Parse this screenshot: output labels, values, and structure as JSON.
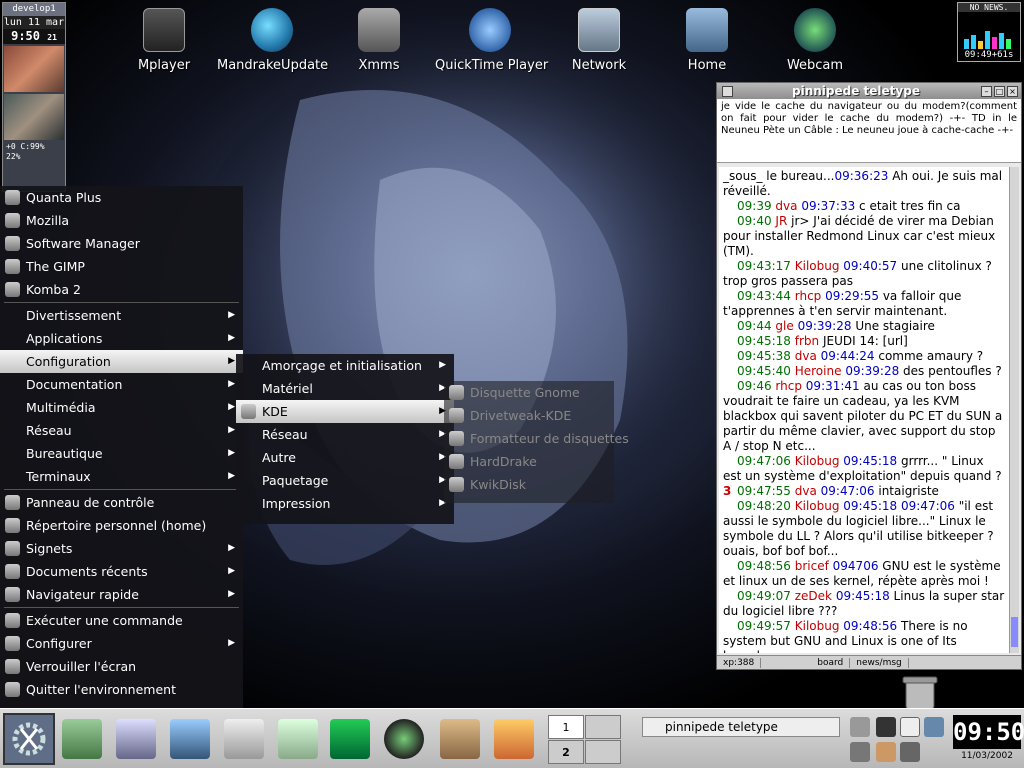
{
  "desktop_icons": [
    {
      "label": "Mplayer",
      "icon": "film-icon"
    },
    {
      "label": "MandrakeUpdate",
      "icon": "globe-icon"
    },
    {
      "label": "Xmms",
      "icon": "speaker-icon"
    },
    {
      "label": "QuickTime Player",
      "icon": "quicktime-icon"
    },
    {
      "label": "Network",
      "icon": "network-icon"
    },
    {
      "label": "Home",
      "icon": "home-icon"
    },
    {
      "label": "Webcam",
      "icon": "webcam-icon"
    }
  ],
  "gkrellm": {
    "host": "develop1",
    "date": "lun 11 mar",
    "time": "9:50",
    "seconds": "21",
    "stats1": "+0  C:99%",
    "stats2": "22%"
  },
  "news_applet": {
    "header": "NO NEWS.",
    "clock": "09:49+61s"
  },
  "chat": {
    "title": "pinnipede teletype",
    "topic": "je vide le cache du navigateur ou du modem?(comment on fait pour vider le cache du modem?) -+- TD in le Neuneu Pète un Câble : Le neuneu joue à cache-cache -+-",
    "messages": [
      {
        "ts": "",
        "nick": "",
        "nickcolor": "",
        "ref": "",
        "text": "_sous_ le bureau...",
        "ref2": "09:36:23",
        "text2": " Ah oui. Je suis mal réveillé."
      },
      {
        "ts": "09:39",
        "nick": "dva",
        "nickcolor": "red",
        "ref": "09:37:33",
        "text": " c etait tres fin ca"
      },
      {
        "ts": "09:40",
        "nick": "JR",
        "nickcolor": "red",
        "ref": "",
        "text": " jr> J'ai décidé de virer ma Debian pour installer Redmond Linux car c'est mieux (TM)."
      },
      {
        "ts": "09:43:17",
        "nick": "Kilobug",
        "nickcolor": "red",
        "ref": "09:40:57",
        "text": " une clitolinux ? trop gros passera pas"
      },
      {
        "ts": "09:43:44",
        "nick": "rhcp",
        "nickcolor": "red",
        "ref": "09:29:55",
        "text": " va falloir que t'apprennes à t'en servir maintenant."
      },
      {
        "ts": "09:44",
        "nick": "gle",
        "nickcolor": "red",
        "ref": "09:39:28",
        "text": " Une stagiaire"
      },
      {
        "ts": "09:45:18",
        "nick": "frbn",
        "nickcolor": "red",
        "ref": "",
        "text": " JEUDI 14: [url]"
      },
      {
        "ts": "09:45:38",
        "nick": "dva",
        "nickcolor": "red",
        "ref": "09:44:24",
        "text": " comme amaury ?"
      },
      {
        "ts": "09:45:40",
        "nick": "Heroine",
        "nickcolor": "red",
        "ref": "09:39:28",
        "text": " des pentoufles ?"
      },
      {
        "ts": "09:46",
        "nick": "rhcp",
        "nickcolor": "red",
        "ref": "09:31:41",
        "text": " au cas ou ton boss voudrait te faire un cadeau, ya les KVM blackbox qui savent piloter du PC ET du SUN a partir du même clavier, avec support du stop A / stop N etc..."
      },
      {
        "ts": "09:47:06",
        "nick": "Kilobug",
        "nickcolor": "red",
        "ref": "09:45:18",
        "text": " grrrr... \" Linux est un système d'exploitation\" depuis quand ?"
      },
      {
        "ts": "09:47:55",
        "nick": "dva",
        "nickcolor": "red",
        "ref": "09:47:06",
        "text": " intaigriste",
        "mark": "3"
      },
      {
        "ts": "09:48:20",
        "nick": "Kilobug",
        "nickcolor": "red",
        "ref": "09:45:18 09:47:06",
        "text": " \"il est aussi le symbole du logiciel libre...\" Linux le symbole du LL ? Alors qu'il utilise bitkeeper ? ouais, bof bof bof..."
      },
      {
        "ts": "09:48:56",
        "nick": "bricef",
        "nickcolor": "red",
        "ref": "094706",
        "text": " GNU est le système et linux un de ses kernel, répète après moi !"
      },
      {
        "ts": "09:49:07",
        "nick": "zeDek",
        "nickcolor": "red",
        "ref": "09:45:18",
        "text": " Linus la super star du logiciel libre ???"
      },
      {
        "ts": "09:49:57",
        "nick": "Kilobug",
        "nickcolor": "red",
        "ref": "09:48:56",
        "text": " There is no system but GNU and Linux is one of Its kernels."
      }
    ],
    "status": {
      "xp": "xp:388",
      "board": "board",
      "news": "news/msg"
    }
  },
  "menu_main": {
    "recent": [
      {
        "label": "Quanta Plus",
        "icon": "quanta-icon"
      },
      {
        "label": "Mozilla",
        "icon": "mozilla-icon"
      },
      {
        "label": "Software Manager",
        "icon": "package-icon"
      },
      {
        "label": "The GIMP",
        "icon": "gimp-icon"
      },
      {
        "label": "Komba 2",
        "icon": "komba-icon"
      }
    ],
    "categories": [
      {
        "label": "Divertissement"
      },
      {
        "label": "Applications"
      },
      {
        "label": "Configuration"
      },
      {
        "label": "Documentation"
      },
      {
        "label": "Multimédia"
      },
      {
        "label": "Réseau"
      },
      {
        "label": "Bureautique"
      },
      {
        "label": "Terminaux"
      }
    ],
    "system": [
      {
        "label": "Panneau de contrôle",
        "icon": "control-panel-icon",
        "sub": false
      },
      {
        "label": "Répertoire personnel (home)",
        "icon": "home-folder-icon",
        "sub": false
      },
      {
        "label": "Signets",
        "icon": "bookmarks-icon",
        "sub": true
      },
      {
        "label": "Documents récents",
        "icon": "document-icon",
        "sub": true
      },
      {
        "label": "Navigateur rapide",
        "icon": "quick-browser-icon",
        "sub": true
      }
    ],
    "actions": [
      {
        "label": "Exécuter une commande",
        "icon": "run-icon",
        "sub": false
      },
      {
        "label": "Configurer",
        "icon": "configure-icon",
        "sub": true
      },
      {
        "label": "Verrouiller l'écran",
        "icon": "lock-icon",
        "sub": false
      },
      {
        "label": "Quitter l'environnement",
        "icon": "logout-icon",
        "sub": false
      }
    ]
  },
  "menu_configuration": [
    {
      "label": "Amorçage et initialisation"
    },
    {
      "label": "Matériel"
    },
    {
      "label": "KDE"
    },
    {
      "label": "Réseau"
    },
    {
      "label": "Autre"
    },
    {
      "label": "Paquetage"
    },
    {
      "label": "Impression"
    }
  ],
  "menu_materiel": [
    {
      "label": "Disquette Gnome"
    },
    {
      "label": "Drivetweak-KDE"
    },
    {
      "label": "Formatteur de disquettes"
    },
    {
      "label": "HardDrake"
    },
    {
      "label": "KwikDisk"
    }
  ],
  "taskbar": {
    "task": "pinnipede teletype",
    "pager": [
      "1",
      "2"
    ],
    "clock_time": "09:50",
    "clock_date": "11/03/2002"
  },
  "colors": {
    "chat_timestamp": "#007000",
    "chat_nick": "#c00000",
    "chat_ref": "#0000c0"
  }
}
